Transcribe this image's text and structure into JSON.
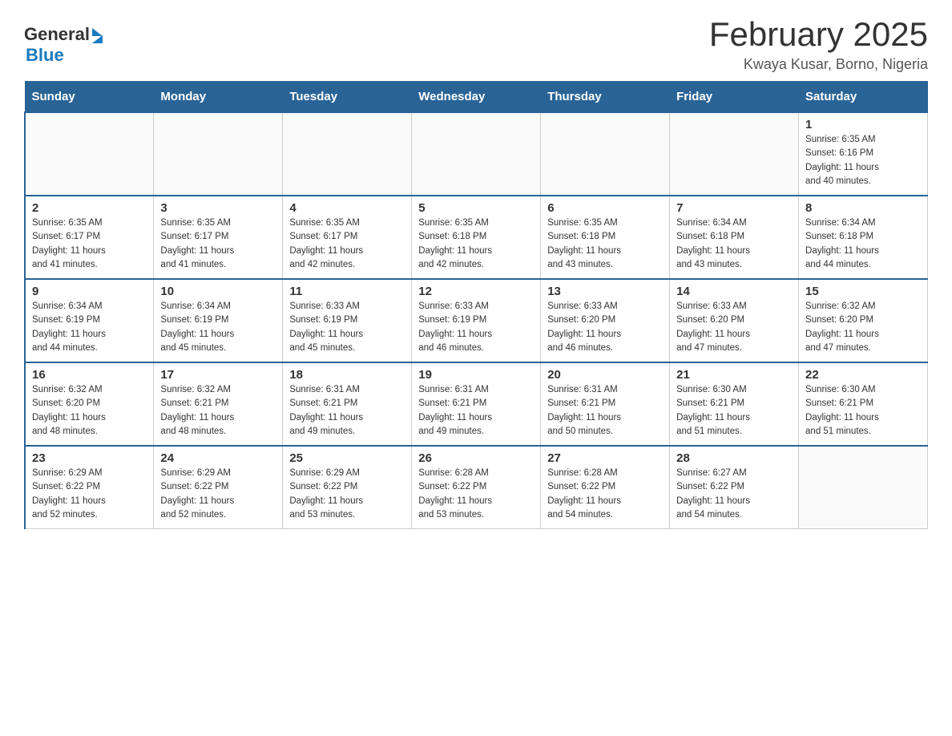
{
  "header": {
    "logo_general": "General",
    "logo_blue": "Blue",
    "title": "February 2025",
    "subtitle": "Kwaya Kusar, Borno, Nigeria"
  },
  "days_of_week": [
    "Sunday",
    "Monday",
    "Tuesday",
    "Wednesday",
    "Thursday",
    "Friday",
    "Saturday"
  ],
  "weeks": [
    [
      {
        "day": "",
        "info": ""
      },
      {
        "day": "",
        "info": ""
      },
      {
        "day": "",
        "info": ""
      },
      {
        "day": "",
        "info": ""
      },
      {
        "day": "",
        "info": ""
      },
      {
        "day": "",
        "info": ""
      },
      {
        "day": "1",
        "info": "Sunrise: 6:35 AM\nSunset: 6:16 PM\nDaylight: 11 hours\nand 40 minutes."
      }
    ],
    [
      {
        "day": "2",
        "info": "Sunrise: 6:35 AM\nSunset: 6:17 PM\nDaylight: 11 hours\nand 41 minutes."
      },
      {
        "day": "3",
        "info": "Sunrise: 6:35 AM\nSunset: 6:17 PM\nDaylight: 11 hours\nand 41 minutes."
      },
      {
        "day": "4",
        "info": "Sunrise: 6:35 AM\nSunset: 6:17 PM\nDaylight: 11 hours\nand 42 minutes."
      },
      {
        "day": "5",
        "info": "Sunrise: 6:35 AM\nSunset: 6:18 PM\nDaylight: 11 hours\nand 42 minutes."
      },
      {
        "day": "6",
        "info": "Sunrise: 6:35 AM\nSunset: 6:18 PM\nDaylight: 11 hours\nand 43 minutes."
      },
      {
        "day": "7",
        "info": "Sunrise: 6:34 AM\nSunset: 6:18 PM\nDaylight: 11 hours\nand 43 minutes."
      },
      {
        "day": "8",
        "info": "Sunrise: 6:34 AM\nSunset: 6:18 PM\nDaylight: 11 hours\nand 44 minutes."
      }
    ],
    [
      {
        "day": "9",
        "info": "Sunrise: 6:34 AM\nSunset: 6:19 PM\nDaylight: 11 hours\nand 44 minutes."
      },
      {
        "day": "10",
        "info": "Sunrise: 6:34 AM\nSunset: 6:19 PM\nDaylight: 11 hours\nand 45 minutes."
      },
      {
        "day": "11",
        "info": "Sunrise: 6:33 AM\nSunset: 6:19 PM\nDaylight: 11 hours\nand 45 minutes."
      },
      {
        "day": "12",
        "info": "Sunrise: 6:33 AM\nSunset: 6:19 PM\nDaylight: 11 hours\nand 46 minutes."
      },
      {
        "day": "13",
        "info": "Sunrise: 6:33 AM\nSunset: 6:20 PM\nDaylight: 11 hours\nand 46 minutes."
      },
      {
        "day": "14",
        "info": "Sunrise: 6:33 AM\nSunset: 6:20 PM\nDaylight: 11 hours\nand 47 minutes."
      },
      {
        "day": "15",
        "info": "Sunrise: 6:32 AM\nSunset: 6:20 PM\nDaylight: 11 hours\nand 47 minutes."
      }
    ],
    [
      {
        "day": "16",
        "info": "Sunrise: 6:32 AM\nSunset: 6:20 PM\nDaylight: 11 hours\nand 48 minutes."
      },
      {
        "day": "17",
        "info": "Sunrise: 6:32 AM\nSunset: 6:21 PM\nDaylight: 11 hours\nand 48 minutes."
      },
      {
        "day": "18",
        "info": "Sunrise: 6:31 AM\nSunset: 6:21 PM\nDaylight: 11 hours\nand 49 minutes."
      },
      {
        "day": "19",
        "info": "Sunrise: 6:31 AM\nSunset: 6:21 PM\nDaylight: 11 hours\nand 49 minutes."
      },
      {
        "day": "20",
        "info": "Sunrise: 6:31 AM\nSunset: 6:21 PM\nDaylight: 11 hours\nand 50 minutes."
      },
      {
        "day": "21",
        "info": "Sunrise: 6:30 AM\nSunset: 6:21 PM\nDaylight: 11 hours\nand 51 minutes."
      },
      {
        "day": "22",
        "info": "Sunrise: 6:30 AM\nSunset: 6:21 PM\nDaylight: 11 hours\nand 51 minutes."
      }
    ],
    [
      {
        "day": "23",
        "info": "Sunrise: 6:29 AM\nSunset: 6:22 PM\nDaylight: 11 hours\nand 52 minutes."
      },
      {
        "day": "24",
        "info": "Sunrise: 6:29 AM\nSunset: 6:22 PM\nDaylight: 11 hours\nand 52 minutes."
      },
      {
        "day": "25",
        "info": "Sunrise: 6:29 AM\nSunset: 6:22 PM\nDaylight: 11 hours\nand 53 minutes."
      },
      {
        "day": "26",
        "info": "Sunrise: 6:28 AM\nSunset: 6:22 PM\nDaylight: 11 hours\nand 53 minutes."
      },
      {
        "day": "27",
        "info": "Sunrise: 6:28 AM\nSunset: 6:22 PM\nDaylight: 11 hours\nand 54 minutes."
      },
      {
        "day": "28",
        "info": "Sunrise: 6:27 AM\nSunset: 6:22 PM\nDaylight: 11 hours\nand 54 minutes."
      },
      {
        "day": "",
        "info": ""
      }
    ]
  ]
}
